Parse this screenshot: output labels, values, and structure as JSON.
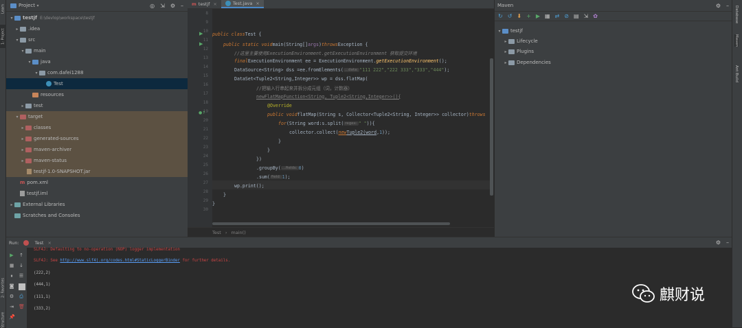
{
  "left_stripe": {
    "tabs": [
      "Learn",
      "1: Project",
      "2: Favorites",
      "Structure"
    ]
  },
  "project_panel": {
    "title": "Project",
    "tree": [
      {
        "label": "testjf",
        "extra": "E:\\devlop\\workspace\\testjf",
        "type": "project"
      },
      {
        "label": ".idea",
        "type": "folder"
      },
      {
        "label": "src",
        "type": "folder"
      },
      {
        "label": "main",
        "type": "folder"
      },
      {
        "label": "java",
        "type": "folder"
      },
      {
        "label": "com.dafei1288",
        "type": "package"
      },
      {
        "label": "Test",
        "type": "class"
      },
      {
        "label": "resources",
        "type": "folder"
      },
      {
        "label": "test",
        "type": "folder"
      },
      {
        "label": "target",
        "type": "folder"
      },
      {
        "label": "classes",
        "type": "folder"
      },
      {
        "label": "generated-sources",
        "type": "folder"
      },
      {
        "label": "maven-archiver",
        "type": "folder"
      },
      {
        "label": "maven-status",
        "type": "folder"
      },
      {
        "label": "testjf-1.0-SNAPSHOT.jar",
        "type": "jar"
      },
      {
        "label": "pom.xml",
        "type": "file"
      },
      {
        "label": "testjf.iml",
        "type": "file"
      },
      {
        "label": "External Libraries",
        "type": "lib"
      },
      {
        "label": "Scratches and Consoles",
        "type": "scratch"
      }
    ]
  },
  "editor": {
    "tabs": [
      "testjf",
      "Test.java"
    ],
    "active_tab": "Test.java",
    "line_numbers": [
      "8",
      "9",
      "10",
      "11",
      "12",
      "13",
      "14",
      "15",
      "16",
      "17",
      "18",
      "19",
      "20",
      "21",
      "22",
      "23",
      "24",
      "25",
      "26",
      "27",
      "28",
      "29",
      "30"
    ],
    "breadcrumb": [
      "Test",
      "main()"
    ],
    "code": {
      "l10_a": "public class",
      "l10_b": " Test {",
      "l11_a": "public static void",
      "l11_b": " main(String[] ",
      "l11_c": "args",
      "l11_d": ") ",
      "l11_e": "throws",
      "l11_f": " Exception {",
      "l12": "//这里主要使用ExecutionEnvironment.getExecutionEnvironment 获取提交环境",
      "l13_a": "final",
      "l13_b": "  ExecutionEnvironment ee = ExecutionEnvironment.",
      "l13_c": "getExecutionEnvironment",
      "l13_d": "();",
      "l14_a": "DataSource<String> dss =ee.fromElements(",
      "l14_hint": "...data:",
      "l14_s": " \"111 222\",\"222 333\",\"333\",\"444\"",
      "l14_b": ");",
      "l15": "DataSet<Tuple2<String,Integer>> wp =  dss.flatMap(",
      "l16": "//把输入行串起来并拆分成元组（词，计数器）",
      "l17_a": "new",
      "l17_b": " FlatMapFunction<String, Tuple2<String,Integer>>(){",
      "l18": "@Override",
      "l19_a": "public void",
      "l19_b": " flatMap(String s, Collector<Tuple2<String, Integer>> collector) ",
      "l19_c": "throws",
      "l20_a": "for",
      "l20_b": "(String word:s.split(",
      "l20_hint": "regex:",
      "l20_s": " \" \"",
      "l20_c": ")){",
      "l21_a": "collector.collect(",
      "l21_b": "new",
      "l21_c": " Tuple2(",
      "l21_d": "word",
      "l21_e": ",",
      "l21_f": "1",
      "l21_g": "));",
      "l22": "}",
      "l23": "}",
      "l24": "})",
      "l25_a": ".groupBy(",
      "l25_hint": "...fields:",
      "l25_n": " 0",
      "l25_b": ")",
      "l26_a": ".sum(",
      "l26_hint": "field:",
      "l26_n": " 1",
      "l26_b": ");",
      "l27": "wp.print();",
      "l28": "}",
      "l29": "}"
    }
  },
  "maven": {
    "title": "Maven",
    "tree": [
      "testjf",
      "Lifecycle",
      "Plugins",
      "Dependencies"
    ]
  },
  "right_stripe": {
    "tabs": [
      "Database",
      "Maven",
      "Ant Build"
    ]
  },
  "run": {
    "label": "Run:",
    "tab": "Test",
    "output": [
      {
        "text": "SLF4J: Defaulting to no-operation (NOP) logger implementation",
        "err": true
      },
      {
        "text": "SLF4J: See ",
        "link": "http://www.slf4j.org/codes.html#StaticLoggerBinder",
        "after": " for further details.",
        "err": true
      },
      {
        "text": "(222,2)",
        "err": false
      },
      {
        "text": "(444,1)",
        "err": false
      },
      {
        "text": "(111,1)",
        "err": false
      },
      {
        "text": "(333,2)",
        "err": false
      }
    ]
  },
  "watermark": {
    "text": "麒财说"
  }
}
